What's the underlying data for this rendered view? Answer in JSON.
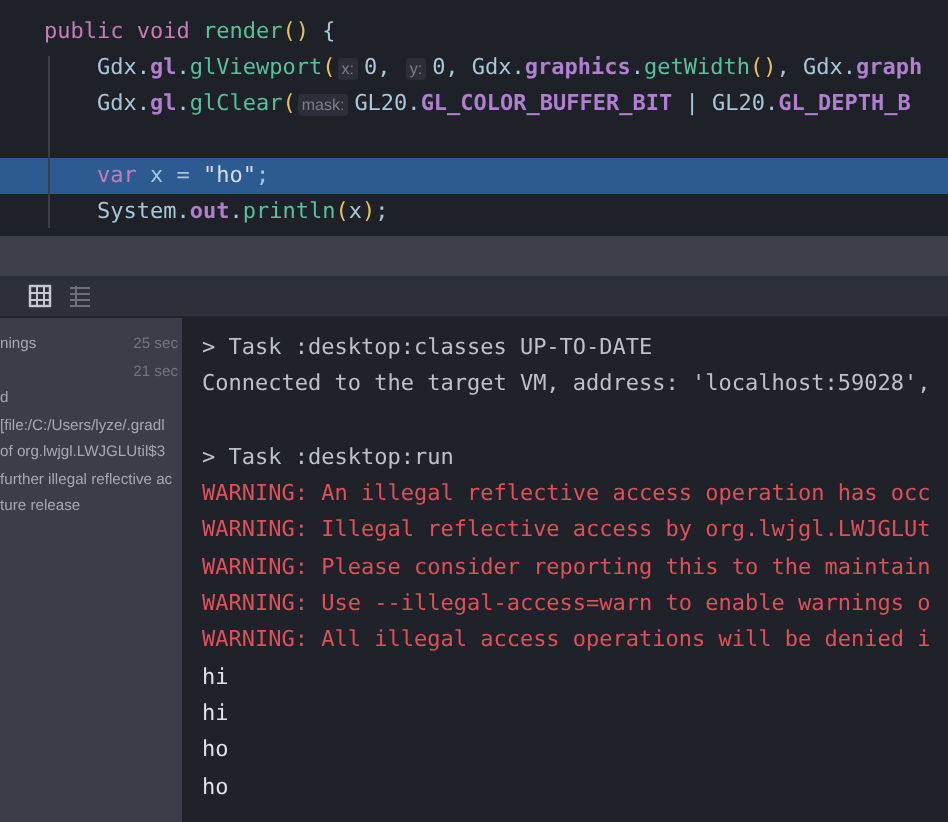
{
  "editor": {
    "lines": [
      {
        "highlighted": false,
        "tokens": [
          {
            "kind": "keyword",
            "text": "public void "
          },
          {
            "kind": "method",
            "text": "render"
          },
          {
            "kind": "paren",
            "text": "()"
          },
          {
            "kind": "plain",
            "text": " {"
          }
        ]
      },
      {
        "highlighted": false,
        "tokens": [
          {
            "kind": "plain",
            "text": "    Gdx."
          },
          {
            "kind": "field",
            "text": "gl"
          },
          {
            "kind": "plain",
            "text": "."
          },
          {
            "kind": "method",
            "text": "glViewport"
          },
          {
            "kind": "paren",
            "text": "("
          },
          {
            "kind": "hint",
            "text": "x:"
          },
          {
            "kind": "plain",
            "text": "0, "
          },
          {
            "kind": "hint",
            "text": "y:"
          },
          {
            "kind": "plain",
            "text": "0, Gdx."
          },
          {
            "kind": "field",
            "text": "graphics"
          },
          {
            "kind": "plain",
            "text": "."
          },
          {
            "kind": "method",
            "text": "getWidth"
          },
          {
            "kind": "paren",
            "text": "()"
          },
          {
            "kind": "plain",
            "text": ", Gdx."
          },
          {
            "kind": "field",
            "text": "graph"
          }
        ]
      },
      {
        "highlighted": false,
        "tokens": [
          {
            "kind": "plain",
            "text": "    Gdx."
          },
          {
            "kind": "field",
            "text": "gl"
          },
          {
            "kind": "plain",
            "text": "."
          },
          {
            "kind": "method",
            "text": "glClear"
          },
          {
            "kind": "paren",
            "text": "("
          },
          {
            "kind": "hint",
            "text": "mask:"
          },
          {
            "kind": "plain",
            "text": "GL20."
          },
          {
            "kind": "field",
            "text": "GL_COLOR_BUFFER_BIT"
          },
          {
            "kind": "plain",
            "text": " | GL20."
          },
          {
            "kind": "field",
            "text": "GL_DEPTH_B"
          }
        ]
      },
      {
        "highlighted": false
      },
      {
        "highlighted": true,
        "tokens": [
          {
            "kind": "keyword",
            "text": "    var"
          },
          {
            "kind": "plain",
            "text": " x = "
          },
          {
            "kind": "string",
            "text": "\"ho\""
          },
          {
            "kind": "plain",
            "text": ";"
          }
        ]
      },
      {
        "highlighted": false,
        "tokens": [
          {
            "kind": "plain",
            "text": "    System."
          },
          {
            "kind": "field",
            "text": "out"
          },
          {
            "kind": "plain",
            "text": "."
          },
          {
            "kind": "method",
            "text": "println"
          },
          {
            "kind": "paren",
            "text": "("
          },
          {
            "kind": "plain",
            "text": "x"
          },
          {
            "kind": "paren",
            "text": ")"
          },
          {
            "kind": "plain",
            "text": ";"
          }
        ]
      }
    ]
  },
  "sidebar": {
    "items": [
      {
        "text": "nings",
        "time": "25 sec"
      },
      {
        "time": "21 sec"
      },
      {
        "text": "d"
      },
      {
        "text": "[file:/C:/Users/lyze/.gradl"
      },
      {
        "text": "of org.lwjgl.LWJGLUtil$3"
      },
      {
        "text": "further illegal reflective ac"
      },
      {
        "text": "ture release"
      }
    ]
  },
  "console": {
    "lines": [
      {
        "kind": "info",
        "text": "> Task :desktop:classes UP-TO-DATE"
      },
      {
        "kind": "info",
        "text": "Connected to the target VM, address: 'localhost:59028',"
      },
      {
        "kind": "blank"
      },
      {
        "kind": "info",
        "text": "> Task :desktop:run"
      },
      {
        "kind": "warning",
        "text": "WARNING: An illegal reflective access operation has occ"
      },
      {
        "kind": "warning",
        "text": "WARNING: Illegal reflective access by org.lwjgl.LWJGLUt"
      },
      {
        "kind": "warning",
        "text": "WARNING: Please consider reporting this to the maintain"
      },
      {
        "kind": "warning",
        "text": "WARNING: Use --illegal-access=warn to enable warnings o"
      },
      {
        "kind": "warning",
        "text": "WARNING: All illegal access operations will be denied i"
      },
      {
        "kind": "output",
        "text": "hi"
      },
      {
        "kind": "output",
        "text": "hi"
      },
      {
        "kind": "output",
        "text": "ho"
      },
      {
        "kind": "output",
        "text": "ho"
      }
    ]
  }
}
